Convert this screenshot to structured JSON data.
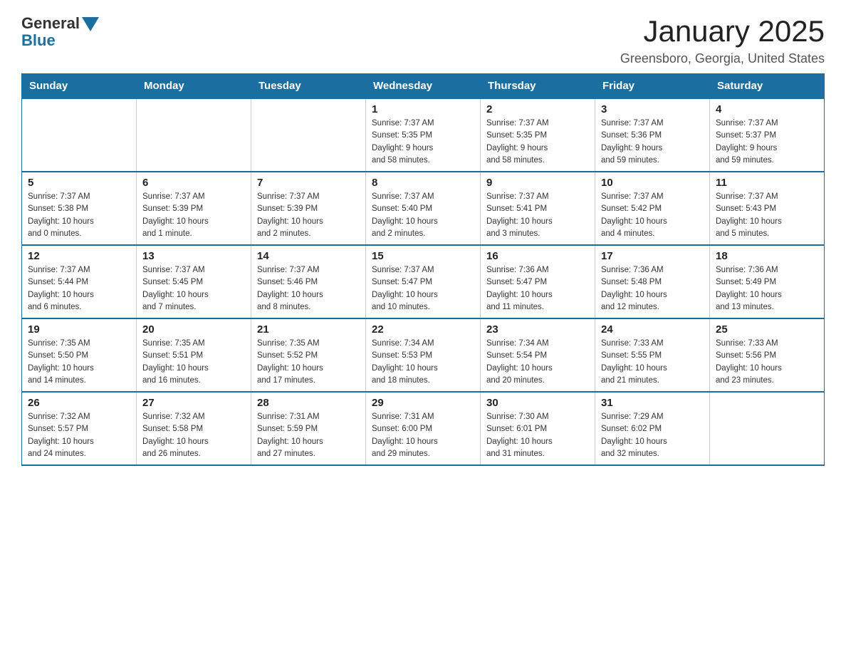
{
  "header": {
    "logo_general": "General",
    "logo_blue": "Blue",
    "main_title": "January 2025",
    "subtitle": "Greensboro, Georgia, United States"
  },
  "days_of_week": [
    "Sunday",
    "Monday",
    "Tuesday",
    "Wednesday",
    "Thursday",
    "Friday",
    "Saturday"
  ],
  "weeks": [
    [
      {
        "day": "",
        "info": ""
      },
      {
        "day": "",
        "info": ""
      },
      {
        "day": "",
        "info": ""
      },
      {
        "day": "1",
        "info": "Sunrise: 7:37 AM\nSunset: 5:35 PM\nDaylight: 9 hours\nand 58 minutes."
      },
      {
        "day": "2",
        "info": "Sunrise: 7:37 AM\nSunset: 5:35 PM\nDaylight: 9 hours\nand 58 minutes."
      },
      {
        "day": "3",
        "info": "Sunrise: 7:37 AM\nSunset: 5:36 PM\nDaylight: 9 hours\nand 59 minutes."
      },
      {
        "day": "4",
        "info": "Sunrise: 7:37 AM\nSunset: 5:37 PM\nDaylight: 9 hours\nand 59 minutes."
      }
    ],
    [
      {
        "day": "5",
        "info": "Sunrise: 7:37 AM\nSunset: 5:38 PM\nDaylight: 10 hours\nand 0 minutes."
      },
      {
        "day": "6",
        "info": "Sunrise: 7:37 AM\nSunset: 5:39 PM\nDaylight: 10 hours\nand 1 minute."
      },
      {
        "day": "7",
        "info": "Sunrise: 7:37 AM\nSunset: 5:39 PM\nDaylight: 10 hours\nand 2 minutes."
      },
      {
        "day": "8",
        "info": "Sunrise: 7:37 AM\nSunset: 5:40 PM\nDaylight: 10 hours\nand 2 minutes."
      },
      {
        "day": "9",
        "info": "Sunrise: 7:37 AM\nSunset: 5:41 PM\nDaylight: 10 hours\nand 3 minutes."
      },
      {
        "day": "10",
        "info": "Sunrise: 7:37 AM\nSunset: 5:42 PM\nDaylight: 10 hours\nand 4 minutes."
      },
      {
        "day": "11",
        "info": "Sunrise: 7:37 AM\nSunset: 5:43 PM\nDaylight: 10 hours\nand 5 minutes."
      }
    ],
    [
      {
        "day": "12",
        "info": "Sunrise: 7:37 AM\nSunset: 5:44 PM\nDaylight: 10 hours\nand 6 minutes."
      },
      {
        "day": "13",
        "info": "Sunrise: 7:37 AM\nSunset: 5:45 PM\nDaylight: 10 hours\nand 7 minutes."
      },
      {
        "day": "14",
        "info": "Sunrise: 7:37 AM\nSunset: 5:46 PM\nDaylight: 10 hours\nand 8 minutes."
      },
      {
        "day": "15",
        "info": "Sunrise: 7:37 AM\nSunset: 5:47 PM\nDaylight: 10 hours\nand 10 minutes."
      },
      {
        "day": "16",
        "info": "Sunrise: 7:36 AM\nSunset: 5:47 PM\nDaylight: 10 hours\nand 11 minutes."
      },
      {
        "day": "17",
        "info": "Sunrise: 7:36 AM\nSunset: 5:48 PM\nDaylight: 10 hours\nand 12 minutes."
      },
      {
        "day": "18",
        "info": "Sunrise: 7:36 AM\nSunset: 5:49 PM\nDaylight: 10 hours\nand 13 minutes."
      }
    ],
    [
      {
        "day": "19",
        "info": "Sunrise: 7:35 AM\nSunset: 5:50 PM\nDaylight: 10 hours\nand 14 minutes."
      },
      {
        "day": "20",
        "info": "Sunrise: 7:35 AM\nSunset: 5:51 PM\nDaylight: 10 hours\nand 16 minutes."
      },
      {
        "day": "21",
        "info": "Sunrise: 7:35 AM\nSunset: 5:52 PM\nDaylight: 10 hours\nand 17 minutes."
      },
      {
        "day": "22",
        "info": "Sunrise: 7:34 AM\nSunset: 5:53 PM\nDaylight: 10 hours\nand 18 minutes."
      },
      {
        "day": "23",
        "info": "Sunrise: 7:34 AM\nSunset: 5:54 PM\nDaylight: 10 hours\nand 20 minutes."
      },
      {
        "day": "24",
        "info": "Sunrise: 7:33 AM\nSunset: 5:55 PM\nDaylight: 10 hours\nand 21 minutes."
      },
      {
        "day": "25",
        "info": "Sunrise: 7:33 AM\nSunset: 5:56 PM\nDaylight: 10 hours\nand 23 minutes."
      }
    ],
    [
      {
        "day": "26",
        "info": "Sunrise: 7:32 AM\nSunset: 5:57 PM\nDaylight: 10 hours\nand 24 minutes."
      },
      {
        "day": "27",
        "info": "Sunrise: 7:32 AM\nSunset: 5:58 PM\nDaylight: 10 hours\nand 26 minutes."
      },
      {
        "day": "28",
        "info": "Sunrise: 7:31 AM\nSunset: 5:59 PM\nDaylight: 10 hours\nand 27 minutes."
      },
      {
        "day": "29",
        "info": "Sunrise: 7:31 AM\nSunset: 6:00 PM\nDaylight: 10 hours\nand 29 minutes."
      },
      {
        "day": "30",
        "info": "Sunrise: 7:30 AM\nSunset: 6:01 PM\nDaylight: 10 hours\nand 31 minutes."
      },
      {
        "day": "31",
        "info": "Sunrise: 7:29 AM\nSunset: 6:02 PM\nDaylight: 10 hours\nand 32 minutes."
      },
      {
        "day": "",
        "info": ""
      }
    ]
  ]
}
